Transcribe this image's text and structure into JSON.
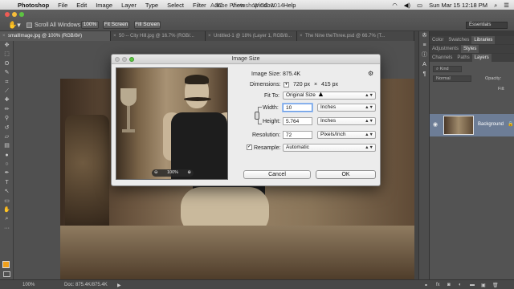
{
  "menubar": {
    "apple": "",
    "app": "Photoshop",
    "items": [
      "File",
      "Edit",
      "Image",
      "Layer",
      "Type",
      "Select",
      "Filter",
      "3D",
      "View",
      "Window",
      "Help"
    ],
    "center_title": "Adobe Photoshop CC 2014",
    "clock": "Sun Mar 15  12:18 PM"
  },
  "options": {
    "scroll_all_windows": "Scroll All Windows",
    "zoom_value": "100%",
    "fit_screen": "Fit Screen",
    "fill_screen": "Fill Screen",
    "workspace": "Essentials"
  },
  "tabs": [
    {
      "label": "smallImage.jpg @ 100% (RGB/8#)",
      "active": true
    },
    {
      "label": "50 -- City Hill.jpg @ 16.7% (RGB/...",
      "active": false
    },
    {
      "label": "Untitled-1 @ 18% (Layer 1, RGB/8...",
      "active": false
    },
    {
      "label": "The Nine theThree.psd @ 66.7% (T...",
      "active": false
    }
  ],
  "panels": {
    "top_tabs": [
      "Color",
      "Swatches",
      "Libraries"
    ],
    "mid_tabs": [
      "Adjustments",
      "Styles"
    ],
    "layer_tabs": [
      "Channels",
      "Paths",
      "Layers"
    ],
    "kind": "Kind",
    "blend": "Normal",
    "opacity_label": "Opacity:",
    "fill_label": "Fill:",
    "layer_name": "Background"
  },
  "status": {
    "zoom": "100%",
    "doc": "Doc: 875.4K/875.4K"
  },
  "dialog": {
    "title": "Image Size",
    "image_size_label": "Image Size:",
    "image_size_value": "875.4K",
    "dimensions_label": "Dimensions:",
    "dim_w": "720 px",
    "dim_x": "×",
    "dim_h": "415 px",
    "fit_to_label": "Fit To:",
    "fit_to_value": "Original Size",
    "width_label": "Width:",
    "width_value": "10",
    "width_unit": "Inches",
    "height_label": "Height:",
    "height_value": "5.764",
    "height_unit": "Inches",
    "resolution_label": "Resolution:",
    "resolution_value": "72",
    "resolution_unit": "Pixels/Inch",
    "resample_label": "Resample:",
    "resample_value": "Automatic",
    "zoom_value": "100%",
    "cancel": "Cancel",
    "ok": "OK"
  }
}
